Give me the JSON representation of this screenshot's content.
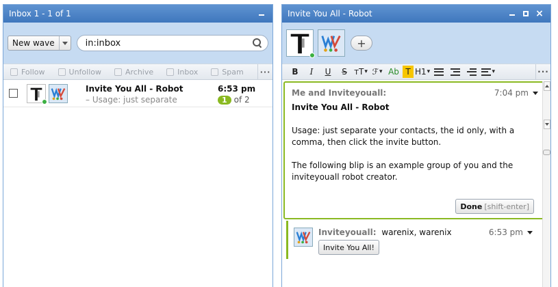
{
  "inbox_panel": {
    "title": "Inbox 1 - 1 of 1",
    "new_wave_label": "New wave",
    "search_value": "in:inbox",
    "actions": [
      "Follow",
      "Unfollow",
      "Archive",
      "Inbox",
      "Spam"
    ],
    "more_label": "···",
    "digest": {
      "title": "Invite You All - Robot",
      "snippet": "– Usage: just separate",
      "time": "6:53 pm",
      "unread": "1",
      "total": "of 2"
    }
  },
  "wave_panel": {
    "title": "Invite You All - Robot",
    "add_label": "+",
    "toolbar": {
      "bold": "B",
      "italic": "I",
      "underline": "U",
      "strike": "S",
      "size": "тT",
      "font": "ℱ",
      "color": "Ab",
      "highlight": "T",
      "heading": "H1",
      "more": "···"
    },
    "blip": {
      "author": "Me and Inviteyouall:",
      "time": "7:04 pm",
      "title": "Invite You All - Robot",
      "para1": "Usage: just separate your contacts, the id only,  with a comma, then click the invite button.",
      "para2": "The following blip is an example group of you and the inviteyouall robot creator.",
      "done_label": "Done",
      "done_hint": "[shift-enter]"
    },
    "reply": {
      "author": "Inviteyouall:",
      "text": "warenix, warenix",
      "time": "6:53 pm",
      "button_label": "Invite You All!"
    }
  },
  "colors": {
    "titlebar": "#4a82c6",
    "header_bg": "#c6dbf2",
    "accent_green": "#8ab921",
    "online": "#3cb043"
  }
}
